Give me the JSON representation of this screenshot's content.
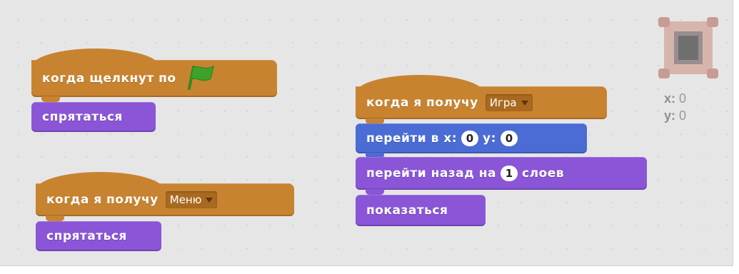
{
  "workspace": {
    "script1": {
      "hat_label": "когда щелкнут по",
      "hat_icon": "green-flag-icon",
      "block1": "спрятаться"
    },
    "script2": {
      "hat_label": "когда я получу",
      "message": "Меню",
      "block1": "спрятаться"
    },
    "script3": {
      "hat_label": "когда я получу",
      "message": "Игра",
      "goto_label": "перейти в x:",
      "x_value": "0",
      "y_label": "y:",
      "y_value": "0",
      "goback_label": "перейти назад на",
      "layers_value": "1",
      "layers_label": "слоев",
      "show_label": "показаться"
    }
  },
  "sprite": {
    "x_label": "x:",
    "x_value": "0",
    "y_label": "y:",
    "y_value": "0"
  },
  "colors": {
    "events": "#c88330",
    "looks": "#8a55d7",
    "motion": "#4a6cd4",
    "flag": "#3fa12a",
    "workspace_bg": "#e6e6e6"
  }
}
